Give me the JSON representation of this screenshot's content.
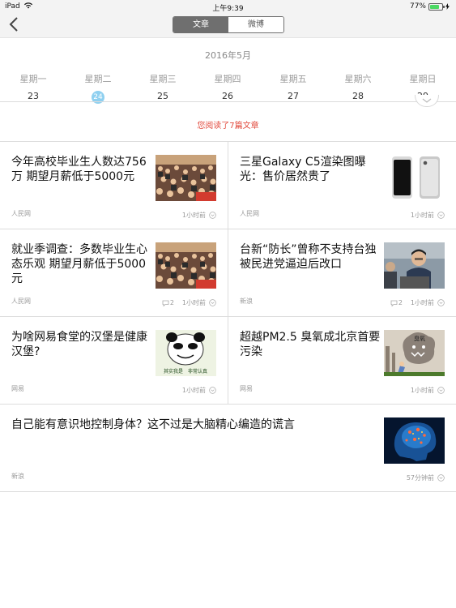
{
  "status_bar": {
    "device": "iPad",
    "time": "上午9:39",
    "battery": "77%",
    "battery_level": 0.77
  },
  "nav": {
    "tabs": [
      "文章",
      "微博"
    ],
    "active_tab": 0
  },
  "calendar": {
    "month": "2016年5月",
    "days": [
      {
        "weekday": "星期一",
        "date": "23"
      },
      {
        "weekday": "星期二",
        "date": "24"
      },
      {
        "weekday": "星期三",
        "date": "25"
      },
      {
        "weekday": "星期四",
        "date": "26"
      },
      {
        "weekday": "星期五",
        "date": "27"
      },
      {
        "weekday": "星期六",
        "date": "28"
      },
      {
        "weekday": "星期日",
        "date": "29"
      }
    ],
    "selected_index": 1
  },
  "read_count": "您阅读了7篇文章",
  "articles": [
    {
      "title": "今年高校毕业生人数达756万 期望月薪低于5000元",
      "source": "人民网",
      "time": "1小时前",
      "comments": "",
      "thumb": "crowd-photo"
    },
    {
      "title": "三星Galaxy C5渲染图曝光：售价居然贵了",
      "source": "人民网",
      "time": "1小时前",
      "comments": "",
      "thumb": "phone-render"
    },
    {
      "title": "就业季调查：多数毕业生心态乐观 期望月薪低于5000元",
      "source": "人民网",
      "time": "1小时前",
      "comments": "2",
      "thumb": "crowd-photo"
    },
    {
      "title": "台新“防长”曾称不支持台独 被民进党逼迫后改口",
      "source": "新浪",
      "time": "1小时前",
      "comments": "2",
      "thumb": "speaker-photo"
    },
    {
      "title": "为啥网易食堂的汉堡是健康汉堡?",
      "source": "网易",
      "time": "1小时前",
      "comments": "",
      "thumb": "panda-meme"
    },
    {
      "title": "超越PM2.5 臭氧成北京首要污染",
      "source": "网易",
      "time": "1小时前",
      "comments": "",
      "thumb": "ozone-cartoon"
    },
    {
      "title": "自己能有意识地控制身体？这不过是大脑精心编造的谎言",
      "source": "新浪",
      "time": "57分钟前",
      "comments": "",
      "thumb": "brain-xray"
    }
  ],
  "thumb_labels": {
    "panda_caption": "其实我是　非常认真",
    "ozone_sign": "臭氧"
  },
  "colors": {
    "accent_red": "#e24b3e",
    "selected_day": "#8fd0f0",
    "segment_dark": "#6f6f6f"
  }
}
